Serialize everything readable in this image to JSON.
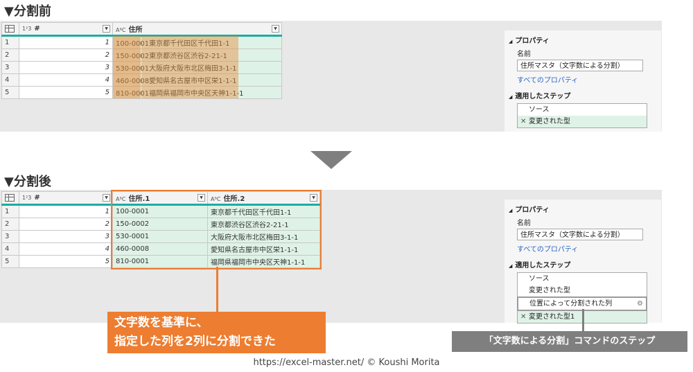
{
  "before": {
    "title": "▼分割前",
    "columns": [
      {
        "type": "1²3",
        "name": "#"
      },
      {
        "type": "AᴮC",
        "name": "住所"
      }
    ],
    "rows": [
      {
        "n": "1",
        "num": "1",
        "addr": "100-0001東京都千代田区千代田1-1"
      },
      {
        "n": "2",
        "num": "2",
        "addr": "150-0002東京都渋谷区渋谷2-21-1"
      },
      {
        "n": "3",
        "num": "3",
        "addr": "530-0001大阪府大阪市北区梅田3-1-1"
      },
      {
        "n": "4",
        "num": "4",
        "addr": "460-0008愛知県名古屋市中区栄1-1-1"
      },
      {
        "n": "5",
        "num": "5",
        "addr": "810-0001福岡県福岡市中央区天神1-1-1"
      }
    ],
    "props": {
      "header": "プロパティ",
      "name_label": "名前",
      "name_value": "住所マスタ（文字数による分割）",
      "all_props": "すべてのプロパティ",
      "steps_header": "適用したステップ",
      "steps": [
        "ソース",
        "変更された型"
      ]
    }
  },
  "after": {
    "title": "▼分割後",
    "columns": [
      {
        "type": "1²3",
        "name": "#"
      },
      {
        "type": "AᴮC",
        "name": "住所.1"
      },
      {
        "type": "AᴮC",
        "name": "住所.2"
      }
    ],
    "rows": [
      {
        "n": "1",
        "num": "1",
        "a1": "100-0001",
        "a2": "東京都千代田区千代田1-1"
      },
      {
        "n": "2",
        "num": "2",
        "a1": "150-0002",
        "a2": "東京都渋谷区渋谷2-21-1"
      },
      {
        "n": "3",
        "num": "3",
        "a1": "530-0001",
        "a2": "大阪府大阪市北区梅田3-1-1"
      },
      {
        "n": "4",
        "num": "4",
        "a1": "460-0008",
        "a2": "愛知県名古屋市中区栄1-1-1"
      },
      {
        "n": "5",
        "num": "5",
        "a1": "810-0001",
        "a2": "福岡県福岡市中央区天神1-1-1"
      }
    ],
    "props": {
      "header": "プロパティ",
      "name_label": "名前",
      "name_value": "住所マスタ（文字数による分割）",
      "all_props": "すべてのプロパティ",
      "steps_header": "適用したステップ",
      "steps": [
        "ソース",
        "変更された型",
        "位置によって分割された列",
        "変更された型1"
      ]
    }
  },
  "callouts": {
    "orange_line1": "文字数を基準に、",
    "orange_line2": "指定した列を2列に分割できた",
    "gray": "「文字数による分割」コマンドのステップ"
  },
  "footer": "https://excel-master.net/  © Koushi Morita",
  "colors": {
    "accent": "#1aaea0",
    "orange": "#ed7d31",
    "gray": "#7f7f7f",
    "cellgreen": "#dff2e7"
  }
}
